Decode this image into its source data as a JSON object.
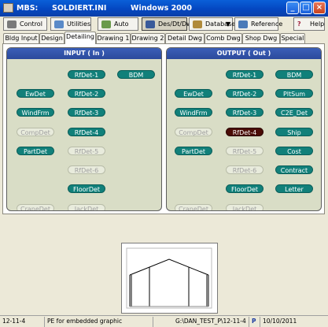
{
  "titlebar": {
    "app": "MBS:",
    "file": "SOLDIERT.INI",
    "os": "Windows 2000"
  },
  "toolbar": {
    "control": "Control",
    "utilities": "Utilities",
    "auto": "Auto",
    "desdtdwg": "Des/Dt/Dwg",
    "database": "Database",
    "reference": "Reference",
    "help": "Help"
  },
  "tabs": [
    "Bldg Input",
    "Design",
    "Detailing",
    "Drawing 1",
    "Drawing 2",
    "Detail Dwg",
    "Comb Dwg",
    "Shop Dwg",
    "Special"
  ],
  "input_panel": {
    "title": "INPUT ( In )",
    "rfdet1": "RfDet-1",
    "bdm": "BDM",
    "ewdet": "EwDet",
    "rfdet2": "RfDet-2",
    "windfrm": "WindFrm",
    "rfdet3": "RfDet-3",
    "compdet": "CompDet",
    "rfdet4": "RfDet-4",
    "partdet": "PartDet",
    "rfdet5": "RfDet-5",
    "rfdet6": "RfDet-6",
    "floordet": "FloorDet",
    "cranedet": "CraneDet",
    "jackdet": "JackDet"
  },
  "output_panel": {
    "title": "OUTPUT ( Out )",
    "rfdet1": "RfDet-1",
    "bdm": "BDM",
    "ewdet": "EwDet",
    "rfdet2": "RfDet-2",
    "pltsum": "PltSum",
    "windfrm": "WindFrm",
    "rfdet3": "RfDet-3",
    "c2e_det": "C2E_Det",
    "compdet": "CompDet",
    "rfdet4": "RfDet-4",
    "ship": "Ship",
    "partdet": "PartDet",
    "rfdet5": "RfDet-5",
    "cost": "Cost",
    "rfdet6": "RfDet-6",
    "contract": "Contract",
    "floordet": "FloorDet",
    "letter": "Letter",
    "cranedet": "CraneDet",
    "jackdet": "JackDet"
  },
  "statusbar": {
    "left": "12-11-4",
    "msg": "PE for embedded graphic",
    "path": "G:\\DAN_TEST_P\\12-11-4",
    "p_icon": "P",
    "date": "10/10/2011"
  },
  "colors": {
    "title_bar": "#0a5fd8",
    "pill_active": "#11807a",
    "pill_selected": "#4a0c06",
    "panel_bg": "#d9ddc6",
    "panel_head": "#2b4a9c"
  }
}
